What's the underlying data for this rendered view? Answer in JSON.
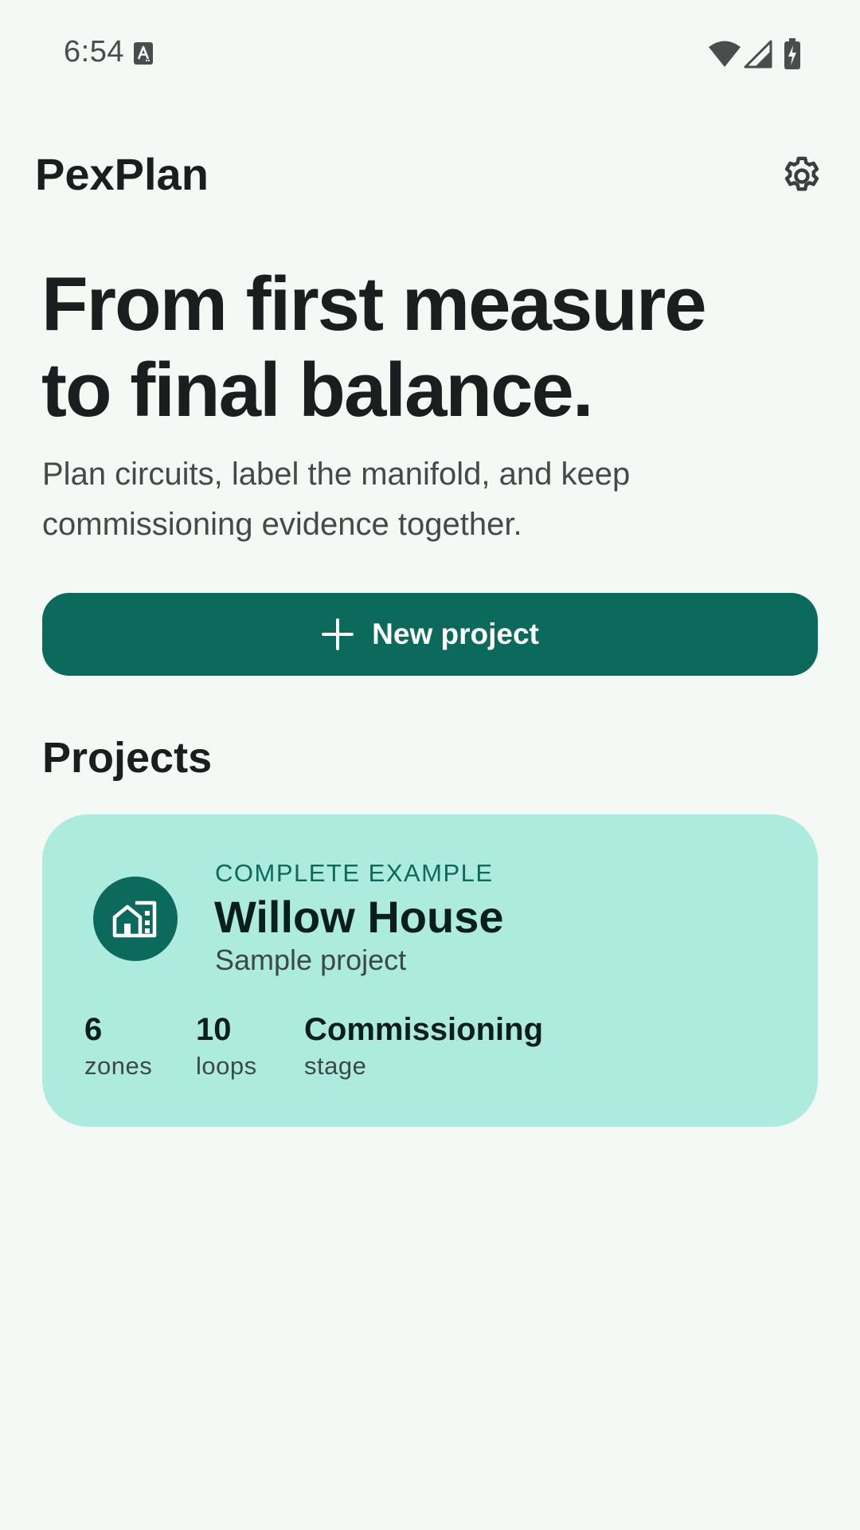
{
  "status_bar": {
    "time": "6:54",
    "notification_icon": "a-box-icon",
    "icons": [
      "wifi-icon",
      "signal-icon",
      "battery-charging-icon"
    ]
  },
  "app_bar": {
    "title": "PexPlan",
    "settings_icon": "gear-icon"
  },
  "hero": {
    "title_lines": [
      "From first measure",
      "to final balance."
    ],
    "subtitle_lines": [
      "Plan circuits, label the manifold, and keep",
      "commissioning evidence together."
    ]
  },
  "new_project_button": {
    "icon": "plus-icon",
    "label": "New project"
  },
  "projects_section": {
    "title": "Projects",
    "items": [
      {
        "eyebrow": "COMPLETE EXAMPLE",
        "name": "Willow House",
        "description": "Sample project",
        "icon": "house-building-icon",
        "stats": [
          {
            "value": "6",
            "label": "zones"
          },
          {
            "value": "10",
            "label": "loops"
          },
          {
            "value": "Commissioning",
            "label": "stage"
          }
        ]
      }
    ]
  },
  "colors": {
    "background": "#f4f9f6",
    "primary": "#0c6a5c",
    "card": "#adebde",
    "text": "#1b1d1e",
    "secondary_text": "#46494a"
  }
}
